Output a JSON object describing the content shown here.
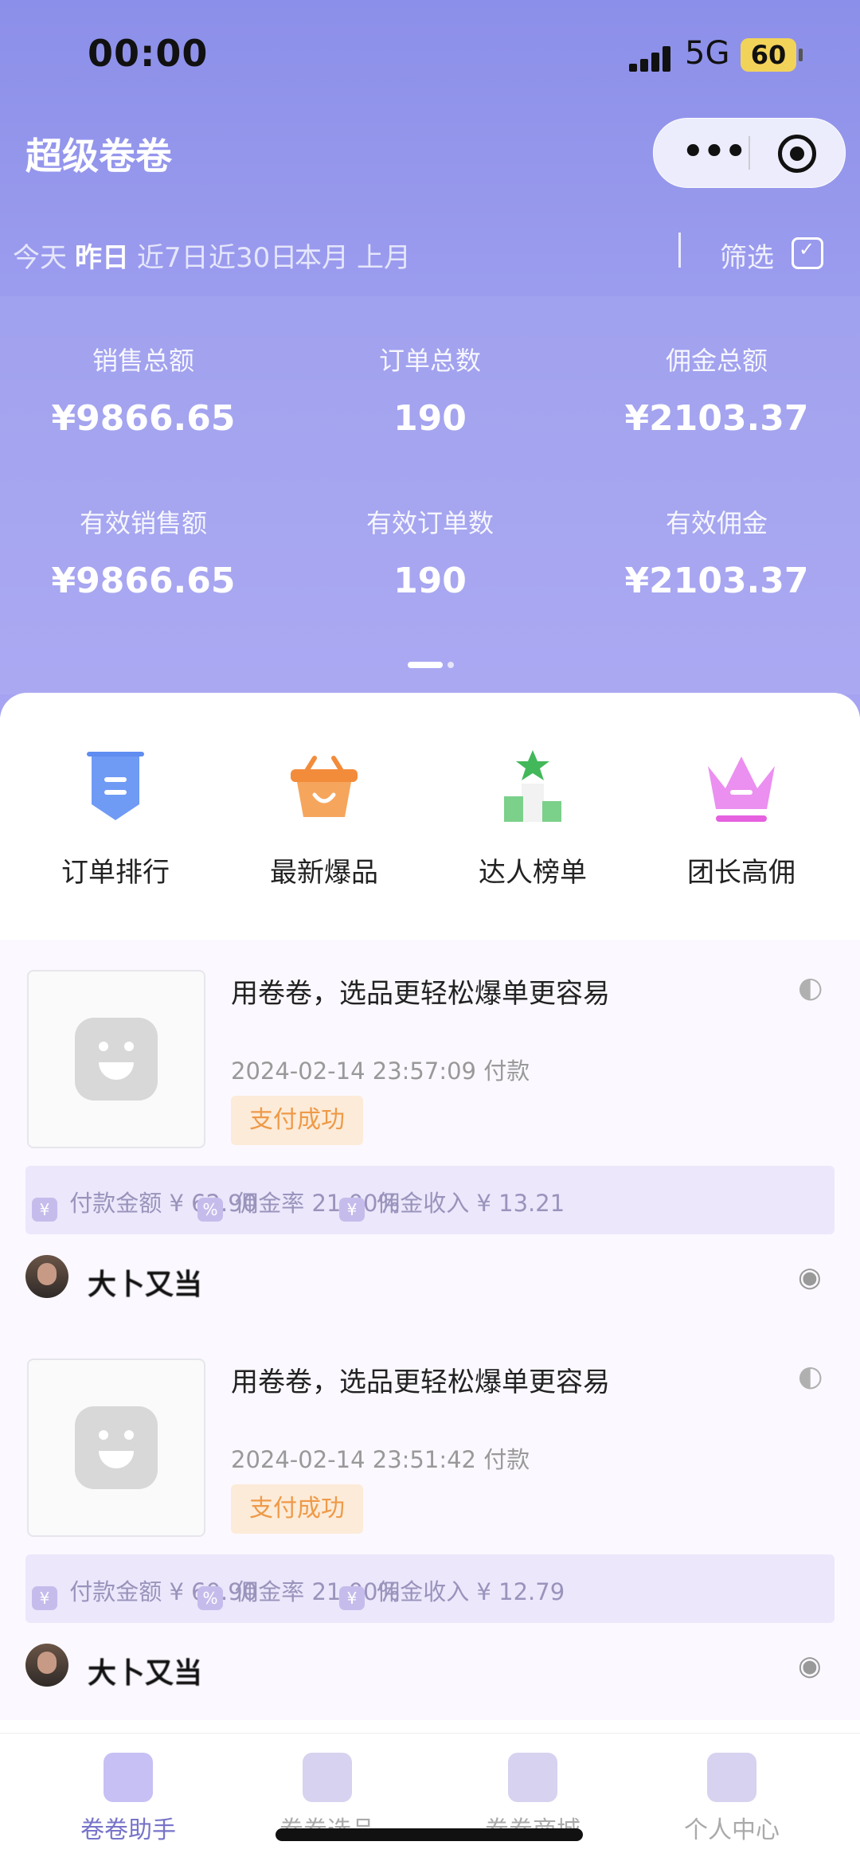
{
  "status_bar": {
    "time": "00:00",
    "network": "5G",
    "battery": "60"
  },
  "app": {
    "title": "超级卷卷"
  },
  "date_tabs": [
    {
      "label": "今天",
      "active": false
    },
    {
      "label": "昨日",
      "active": true
    },
    {
      "label": "近7日",
      "active": false
    },
    {
      "label": "近30日",
      "active": false
    },
    {
      "label": "本月",
      "active": false
    },
    {
      "label": "上月",
      "active": false
    }
  ],
  "filter_label": "筛选",
  "stats": [
    {
      "label": "销售总额",
      "value": "¥9866.65"
    },
    {
      "label": "订单总数",
      "value": "190"
    },
    {
      "label": "佣金总额",
      "value": "¥2103.37"
    },
    {
      "label": "有效销售额",
      "value": "¥9866.65"
    },
    {
      "label": "有效订单数",
      "value": "190"
    },
    {
      "label": "有效佣金",
      "value": "¥2103.37"
    }
  ],
  "menu": [
    {
      "label": "订单排行",
      "icon": "ribbon-list-icon",
      "color": "#5f8df0"
    },
    {
      "label": "最新爆品",
      "icon": "basket-icon",
      "color": "#f28c3b"
    },
    {
      "label": "达人榜单",
      "icon": "podium-star-icon",
      "color": "#56c06a"
    },
    {
      "label": "团长高佣",
      "icon": "crown-icon",
      "color": "#e561df"
    }
  ],
  "orders": [
    {
      "title": "用卷卷，选品更轻松爆单更容易",
      "time": "2024-02-14 23:57:09 付款",
      "status": "支付成功",
      "pay_label": "付款金额",
      "pay_value": "¥ 62.90",
      "rate_label": "佣金率",
      "rate_value": "21.00%",
      "income_label": "佣金收入",
      "income_value": "¥ 13.21",
      "nickname": "大卜又当"
    },
    {
      "title": "用卷卷，选品更轻松爆单更容易",
      "time": "2024-02-14 23:51:42 付款",
      "status": "支付成功",
      "pay_label": "付款金额",
      "pay_value": "¥ 60.90",
      "rate_label": "佣金率",
      "rate_value": "21.00%",
      "income_label": "佣金收入",
      "income_value": "¥ 12.79",
      "nickname": "大卜又当"
    }
  ],
  "tabs": [
    {
      "label": "卷卷助手",
      "active": true
    },
    {
      "label": "卷卷选品",
      "active": false
    },
    {
      "label": "卷卷商城",
      "active": false
    },
    {
      "label": "个人中心",
      "active": false
    }
  ],
  "colors": {
    "accent": "#8c8fe9",
    "badge_bg": "#fcebd8",
    "badge_text": "#ee9a49"
  }
}
